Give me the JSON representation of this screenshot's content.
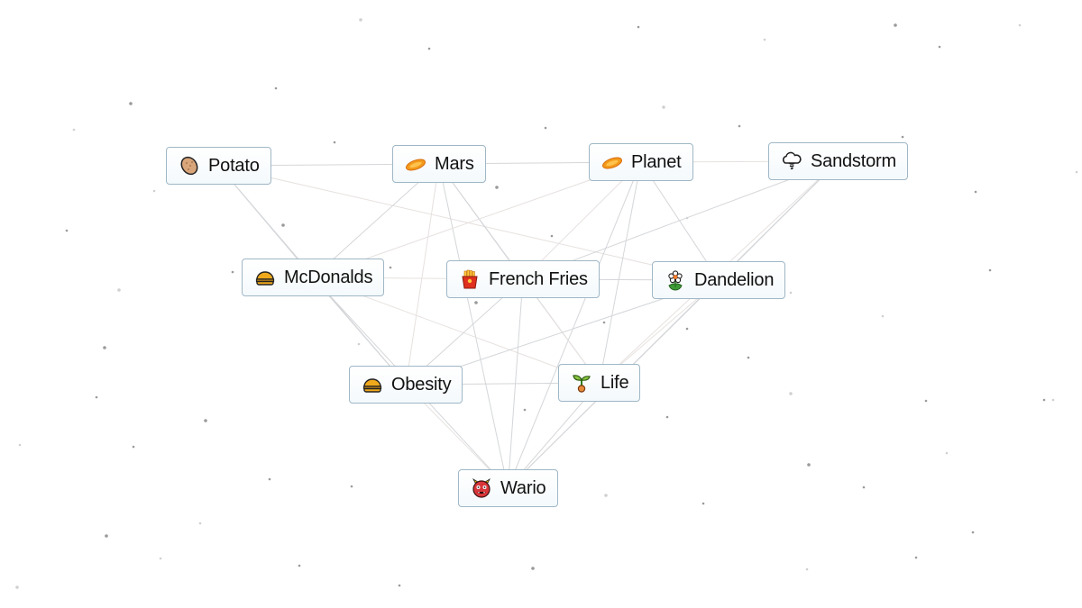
{
  "canvas": {
    "background": "#ffffff",
    "line_color": "#d4d6d9",
    "node_border": "#9fb7c6"
  },
  "nodes": [
    {
      "id": "potato",
      "label": "Potato",
      "icon": "potato-icon"
    },
    {
      "id": "mars",
      "label": "Mars",
      "icon": "planet-icon"
    },
    {
      "id": "planet",
      "label": "Planet",
      "icon": "planet-icon"
    },
    {
      "id": "sandstorm",
      "label": "Sandstorm",
      "icon": "tornado-cloud-icon"
    },
    {
      "id": "mcdonalds",
      "label": "McDonalds",
      "icon": "burger-icon"
    },
    {
      "id": "frenchfries",
      "label": "French Fries",
      "icon": "fries-icon"
    },
    {
      "id": "dandelion",
      "label": "Dandelion",
      "icon": "flower-icon"
    },
    {
      "id": "obesity",
      "label": "Obesity",
      "icon": "burger-icon"
    },
    {
      "id": "life",
      "label": "Life",
      "icon": "seedling-icon"
    },
    {
      "id": "wario",
      "label": "Wario",
      "icon": "ogre-icon"
    }
  ],
  "edges": [
    [
      "potato",
      "mars"
    ],
    [
      "mars",
      "planet"
    ],
    [
      "planet",
      "sandstorm"
    ],
    [
      "potato",
      "mcdonalds"
    ],
    [
      "potato",
      "obesity"
    ],
    [
      "potato",
      "dandelion"
    ],
    [
      "mars",
      "mcdonalds"
    ],
    [
      "mars",
      "frenchfries"
    ],
    [
      "mars",
      "obesity"
    ],
    [
      "mars",
      "wario"
    ],
    [
      "mars",
      "life"
    ],
    [
      "planet",
      "frenchfries"
    ],
    [
      "planet",
      "dandelion"
    ],
    [
      "planet",
      "life"
    ],
    [
      "planet",
      "mcdonalds"
    ],
    [
      "planet",
      "wario"
    ],
    [
      "sandstorm",
      "frenchfries"
    ],
    [
      "sandstorm",
      "life"
    ],
    [
      "sandstorm",
      "wario"
    ],
    [
      "sandstorm",
      "dandelion"
    ],
    [
      "mcdonalds",
      "frenchfries"
    ],
    [
      "mcdonalds",
      "obesity"
    ],
    [
      "mcdonalds",
      "wario"
    ],
    [
      "mcdonalds",
      "life"
    ],
    [
      "frenchfries",
      "dandelion"
    ],
    [
      "frenchfries",
      "obesity"
    ],
    [
      "frenchfries",
      "life"
    ],
    [
      "frenchfries",
      "wario"
    ],
    [
      "dandelion",
      "obesity"
    ],
    [
      "dandelion",
      "life"
    ],
    [
      "dandelion",
      "wario"
    ],
    [
      "obesity",
      "life"
    ],
    [
      "obesity",
      "wario"
    ],
    [
      "life",
      "wario"
    ]
  ]
}
